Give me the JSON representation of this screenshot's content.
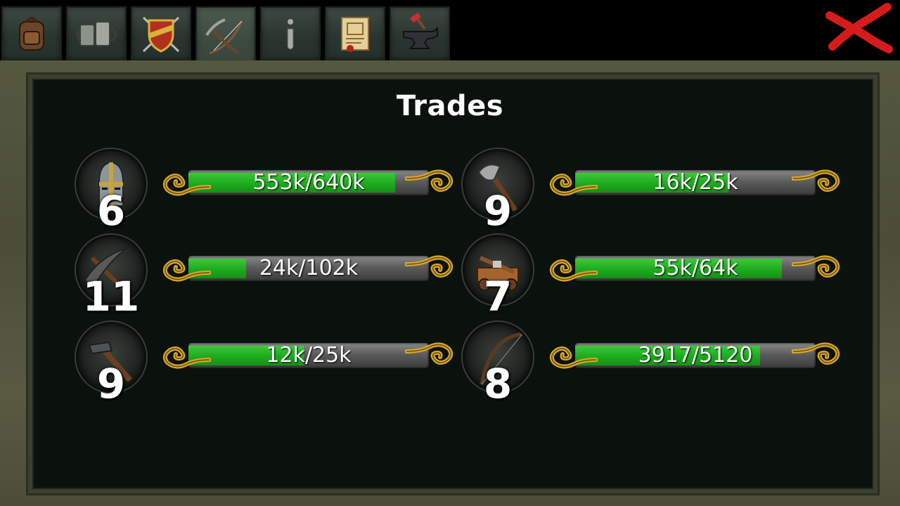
{
  "tabs": [
    {
      "name": "inventory",
      "icon": "backpack-icon",
      "active": false
    },
    {
      "name": "tavern",
      "icon": "tankards-icon",
      "active": false
    },
    {
      "name": "combat",
      "icon": "shield-swords-icon",
      "active": false
    },
    {
      "name": "trades",
      "icon": "pickaxe-bow-icon",
      "active": true
    },
    {
      "name": "info",
      "icon": "info-icon",
      "active": false
    },
    {
      "name": "quests",
      "icon": "scroll-map-icon",
      "active": false
    },
    {
      "name": "crafting",
      "icon": "anvil-icon",
      "active": false
    }
  ],
  "title": "Trades",
  "trades": [
    {
      "icon": "helmet-icon",
      "level": "6",
      "progress_label": "553k/640k",
      "progress": 0.86
    },
    {
      "icon": "axe-icon",
      "level": "9",
      "progress_label": "16k/25k",
      "progress": 0.64
    },
    {
      "icon": "pickaxe-icon",
      "level": "11",
      "progress_label": "24k/102k",
      "progress": 0.24
    },
    {
      "icon": "siege-engine-icon",
      "level": "7",
      "progress_label": "55k/64k",
      "progress": 0.86
    },
    {
      "icon": "hammer-icon",
      "level": "9",
      "progress_label": "12k/25k",
      "progress": 0.48
    },
    {
      "icon": "bow-icon",
      "level": "8",
      "progress_label": "3917/5120",
      "progress": 0.77
    }
  ],
  "colors": {
    "progress": "#1fae20",
    "background": "#0b110c",
    "close": "#d41c1c",
    "ornament": "#d6a82a"
  }
}
